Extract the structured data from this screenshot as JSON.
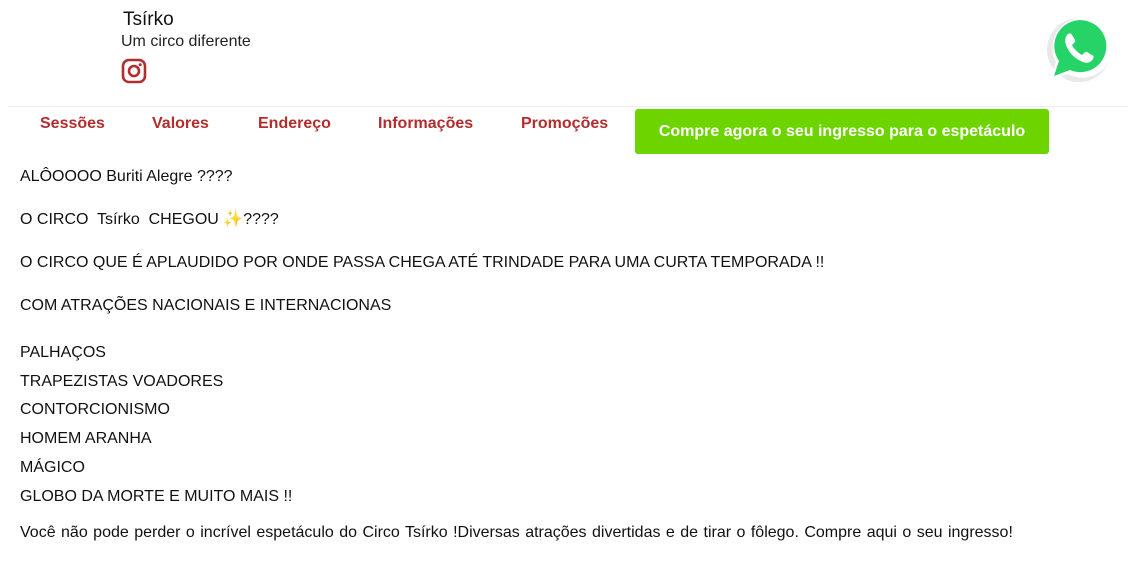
{
  "brand": {
    "name": "Tsírko",
    "tagline": "Um circo diferente",
    "instagram_icon": "instagram-icon",
    "instagram_color": "#b32d2e"
  },
  "whatsapp": {
    "icon": "whatsapp-icon",
    "color": "#25d366"
  },
  "nav": {
    "items": [
      {
        "label": "Sessões"
      },
      {
        "label": "Valores"
      },
      {
        "label": "Endereço"
      },
      {
        "label": "Informações"
      },
      {
        "label": "Promoções"
      }
    ],
    "cta_label": "Compre agora o seu ingresso para o espetáculo",
    "link_color": "#b32d2e",
    "cta_color": "#6dd400"
  },
  "content": {
    "line1": "ALÔOOOO Buriti Alegre ????",
    "line2": "O CIRCO  Tsírko  CHEGOU ✨????",
    "line3": "O CIRCO QUE É APLAUDIDO POR ONDE PASSA CHEGA ATÉ TRINDADE PARA UMA CURTA TEMPORADA !!",
    "line4": "COM ATRAÇÕES NACIONAIS E INTERNACIONAS",
    "attractions": [
      "PALHAÇOS",
      "TRAPEZISTAS VOADORES",
      "CONTORCIONISMO",
      "HOMEM ARANHA",
      "MÁGICO",
      "GLOBO DA MORTE E MUITO MAIS !!"
    ],
    "closing": "Você não pode perder o incrível espetáculo do Circo Tsírko !Diversas atrações divertidas e de tirar o fôlego. Compre aqui o seu ingresso!"
  }
}
